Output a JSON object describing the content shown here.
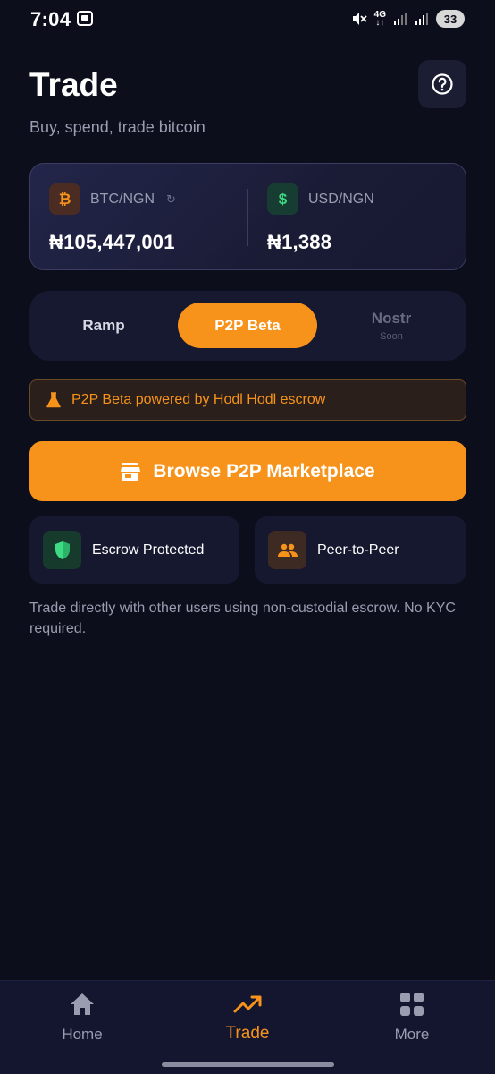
{
  "status_bar": {
    "time": "7:04",
    "network": "4G",
    "battery": "33"
  },
  "header": {
    "title": "Trade",
    "subtitle": "Buy, spend, trade bitcoin",
    "help_icon": "help-circle-icon"
  },
  "rates": [
    {
      "pair": "BTC/NGN",
      "value": "₦105,447,001",
      "icon": "bitcoin-icon",
      "icon_glyph": "₿"
    },
    {
      "pair": "USD/NGN",
      "value": "₦1,388",
      "icon": "dollar-icon",
      "icon_glyph": "$"
    }
  ],
  "tabs": [
    {
      "label": "Ramp",
      "sub": "",
      "active": false
    },
    {
      "label": "P2P Beta",
      "sub": "",
      "active": true
    },
    {
      "label": "Nostr",
      "sub": "Soon",
      "active": false
    }
  ],
  "banner": {
    "text": "P2P Beta powered by Hodl Hodl escrow",
    "icon": "flask-icon"
  },
  "browse_button": {
    "label": "Browse P2P Marketplace",
    "icon": "store-icon"
  },
  "features": [
    {
      "label": "Escrow Protected",
      "icon": "shield-icon"
    },
    {
      "label": "Peer-to-Peer",
      "icon": "people-icon"
    }
  ],
  "description": "Trade directly with other users using non-custodial escrow. No KYC required.",
  "bottom_nav": [
    {
      "label": "Home",
      "icon": "home-icon",
      "active": false
    },
    {
      "label": "Trade",
      "icon": "trending-up-icon",
      "active": true
    },
    {
      "label": "More",
      "icon": "grid-icon",
      "active": false
    }
  ],
  "colors": {
    "background": "#0d0e1b",
    "accent": "#f7931a",
    "card": "#161830",
    "muted_text": "#9a9cb0"
  }
}
